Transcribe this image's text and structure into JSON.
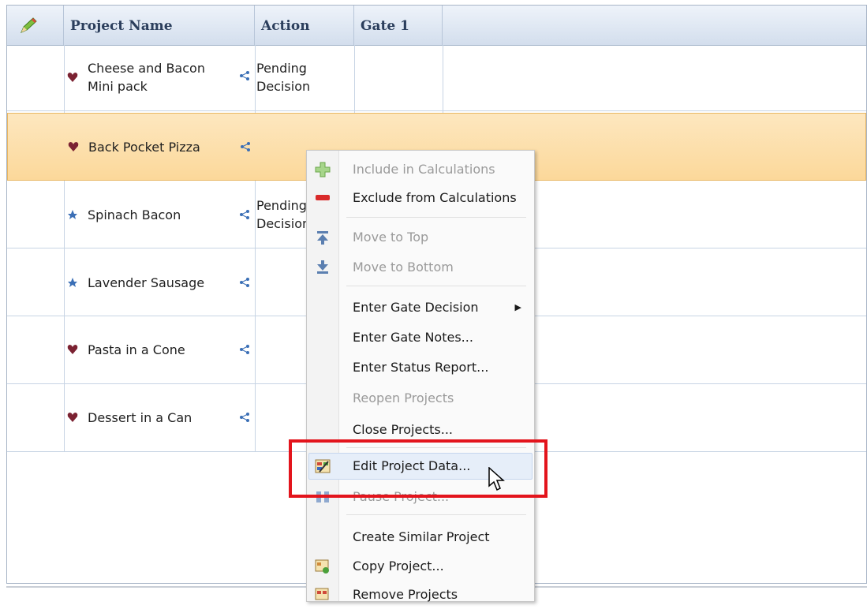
{
  "grid": {
    "columns": [
      "Project Name",
      "Action",
      "Gate 1"
    ],
    "rows": [
      {
        "name": "Cheese and Bacon Mini pack",
        "name_line1": "Cheese and Bacon",
        "name_line2": "Mini pack",
        "action_line1": "Pending",
        "action_line2": "Decision",
        "icon": "project-heart-icon"
      },
      {
        "name": "Back Pocket Pizza",
        "action_line1": "",
        "action_line2": "",
        "icon": "project-heart-icon",
        "selected": true
      },
      {
        "name": "Spinach Bacon",
        "action_line1": "Pending",
        "action_line2": "Decision",
        "icon": "project-star-icon"
      },
      {
        "name": "Lavender Sausage",
        "action_line1": "",
        "action_line2": "",
        "icon": "project-star-icon"
      },
      {
        "name": "Pasta in a Cone",
        "action_line1": "",
        "action_line2": "",
        "icon": "project-heart-icon"
      },
      {
        "name": "Dessert in a Can",
        "action_line1": "",
        "action_line2": "",
        "icon": "project-heart-icon"
      }
    ]
  },
  "context_menu": {
    "items": [
      {
        "label": "Include in Calculations",
        "enabled": false,
        "icon": "plus-icon"
      },
      {
        "label": "Exclude from Calculations",
        "enabled": true,
        "icon": "minus-icon"
      },
      {
        "label": "Move to Top",
        "enabled": false,
        "icon": "move-top-icon"
      },
      {
        "label": "Move to Bottom",
        "enabled": false,
        "icon": "move-bottom-icon"
      },
      {
        "label": "Enter Gate Decision",
        "enabled": true,
        "submenu": true
      },
      {
        "label": "Enter Gate Notes...",
        "enabled": true
      },
      {
        "label": "Enter Status Report...",
        "enabled": true
      },
      {
        "label": "Reopen Projects",
        "enabled": false
      },
      {
        "label": "Close Projects...",
        "enabled": true
      },
      {
        "label": "Edit Project Data...",
        "enabled": true,
        "icon": "edit-data-icon",
        "hovered": true
      },
      {
        "label": "Pause Project...",
        "enabled": false,
        "icon": "pause-icon"
      },
      {
        "label": "Create Similar Project",
        "enabled": true
      },
      {
        "label": "Copy Project...",
        "enabled": true,
        "icon": "copy-project-icon"
      },
      {
        "label": "Remove Projects",
        "enabled": true,
        "icon": "remove-projects-icon"
      }
    ]
  },
  "colors": {
    "selection": "#fcd89a",
    "highlight_box": "#e3141c",
    "header": "#d3deed"
  }
}
